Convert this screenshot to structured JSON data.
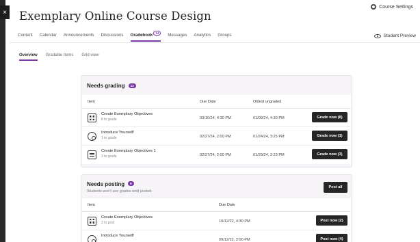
{
  "header": {
    "course_title": "Exemplary Online Course Design",
    "course_settings": "Course Settings",
    "student_preview": "Student Preview",
    "close_label": "×"
  },
  "nav": {
    "items": [
      {
        "label": "Content"
      },
      {
        "label": "Calendar"
      },
      {
        "label": "Announcements"
      },
      {
        "label": "Discussions"
      },
      {
        "label": "Gradebook",
        "count": "14",
        "active": true
      },
      {
        "label": "Messages"
      },
      {
        "label": "Analytics"
      },
      {
        "label": "Groups"
      }
    ]
  },
  "subtabs": [
    {
      "label": "Overview",
      "active": true
    },
    {
      "label": "Gradable items"
    },
    {
      "label": "Grid view"
    }
  ],
  "needs_grading": {
    "title": "Needs grading",
    "count": "14",
    "headers": {
      "item": "Item",
      "due": "Due Date",
      "oldest": "Oldest ungraded"
    },
    "rows": [
      {
        "icon": "assignment-grid-icon",
        "name": "Create Exemplary Objectives",
        "meta": "8 to grade",
        "due": "03/10/24, 4:30 PM",
        "oldest": "01/09/24, 4:30 PM",
        "button": "Grade now (8)"
      },
      {
        "icon": "discussion-icon",
        "name": "Introduce Yourself!",
        "meta": "1 to grade",
        "due": "02/27/24, 2:00 PM",
        "oldest": "01/24/24, 3:25 PM",
        "button": "Grade now (1)"
      },
      {
        "icon": "test-list-icon",
        "name": "Create Exemplary Objectives 1",
        "meta": "3 to grade",
        "due": "02/27/24, 2:00 PM",
        "oldest": "01/29/24, 2:23 PM",
        "button": "Grade now (3)"
      }
    ]
  },
  "needs_posting": {
    "title": "Needs posting",
    "count": "6",
    "subtitle": "Students won't see grades until posted.",
    "post_all": "Post all",
    "headers": {
      "item": "Item",
      "due": "Due Date"
    },
    "rows": [
      {
        "icon": "assignment-grid-icon",
        "name": "Create Exemplary Objectives",
        "meta": "2 to post",
        "due": "10/12/22, 4:30 PM",
        "button": "Post now (2)"
      },
      {
        "icon": "discussion-icon",
        "name": "Introduce Yourself!",
        "meta": "",
        "due": "09/12/22, 2:00 PM",
        "button": "Post now (4)"
      }
    ]
  },
  "colors": {
    "accent": "#7c3aa8",
    "button": "#262626",
    "panel": "#f6f4f7"
  }
}
